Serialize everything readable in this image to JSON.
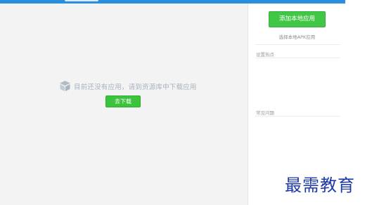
{
  "main": {
    "empty_message": "目前还没有应用，请到资源库中下载应用",
    "download_button": "去下载",
    "box_icon": "package-box-icon"
  },
  "sidebar": {
    "add_local_app_button": "添加本地应用",
    "select_local_apk_link": "选择本地APK应用",
    "section_1_title": "设置热点",
    "section_2_title": "常见问题"
  },
  "watermark": "最需教育",
  "colors": {
    "accent_blue": "#2b8de0",
    "button_green": "#42c645",
    "main_background": "#f3f3f3",
    "watermark_blue": "#1e3aa8"
  }
}
